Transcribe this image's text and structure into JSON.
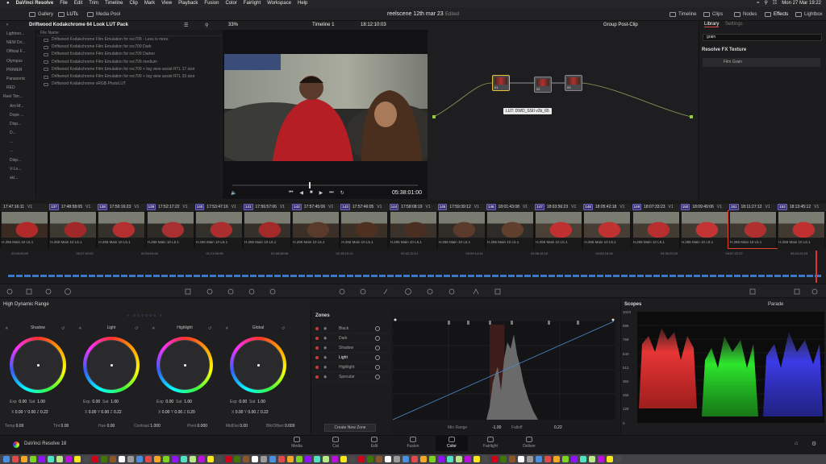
{
  "menubar": {
    "app": "DaVinci Resolve",
    "items": [
      "File",
      "Edit",
      "Trim",
      "Timeline",
      "Clip",
      "Mark",
      "View",
      "Playback",
      "Fusion",
      "Color",
      "Fairlight",
      "Workspace",
      "Help"
    ],
    "datetime": "Mon 27 Mar 19:22"
  },
  "pagebar": {
    "gallery": "Gallery",
    "luts": "LUTs",
    "media_pool": "Media Pool",
    "project_title": "reelscene 12th mar 23",
    "edited": "Edited",
    "timeline": "Timeline",
    "clips": "Clips",
    "nodes": "Nodes",
    "effects": "Effects",
    "lightbox": "Lightbox"
  },
  "toolbar": {
    "lut_pack": "Driftwood Kodakchrome 64 Look LUT Pack",
    "zoom": "33%",
    "timeline_name": "Timeline 1",
    "timecode": "18:12:10:03",
    "node_mode": "Group Post-Clip",
    "library_tab": "Library",
    "settings_tab": "Settings"
  },
  "sidebar": {
    "items": [
      "Lightroo...",
      "NEW Dri...",
      "Official F...",
      "Olympus",
      "PRIMER",
      "Panasonic",
      "RED",
      "Reel Tim...",
      "Arri M...",
      "Dope ...",
      "Disp...",
      "D...",
      "...",
      "...",
      "Disp...",
      "V-Lo...",
      "ski..."
    ]
  },
  "lut_list": {
    "header": "File Name",
    "items": [
      "Driftwood Kodakchrome Film Emulation for rec709 - Less is more",
      "Driftwood Kodakchrome Film Emulation for rec709 Dark",
      "Driftwood Kodakchrome Film Emulation for rec709 Darker",
      "Driftwood Kodakchrome Film Emulation for rec709 medium",
      "Driftwood Kodakchrome Film Emulation for rec709 + log view assist RTL 17 size",
      "Driftwood Kodakchrome Film Emulation for rec709 + log view assist RTL 33 size",
      "Driftwood Kodakchrome sRGB PhotoLUT"
    ]
  },
  "viewer": {
    "timecode": "05:38:01:00"
  },
  "nodes": {
    "labels": [
      "01",
      "02",
      "03"
    ],
    "tooltip": "LUT: DWD_SSII v2b_65"
  },
  "library": {
    "search_value": "grain",
    "section_title": "Resolve FX Texture",
    "effect_item": "Film Grain"
  },
  "clips": [
    {
      "num": "",
      "tc": "17:47:16:11",
      "track": "V1"
    },
    {
      "num": "137",
      "tc": "17:48:58:05",
      "track": "V1"
    },
    {
      "num": "138",
      "tc": "17:50:16:23",
      "track": "V1"
    },
    {
      "num": "139",
      "tc": "17:52:17:22",
      "track": "V1"
    },
    {
      "num": "140",
      "tc": "17:53:47:16",
      "track": "V1"
    },
    {
      "num": "141",
      "tc": "17:56:57:06",
      "track": "V1"
    },
    {
      "num": "142",
      "tc": "17:57:45:06",
      "track": "V1"
    },
    {
      "num": "143",
      "tc": "17:57:46:05",
      "track": "V1"
    },
    {
      "num": "144",
      "tc": "17:58:08:19",
      "track": "V1"
    },
    {
      "num": "145",
      "tc": "17:59:39:12",
      "track": "V1"
    },
    {
      "num": "146",
      "tc": "18:01:43:08",
      "track": "V1"
    },
    {
      "num": "147",
      "tc": "18:03:56:23",
      "track": "V1"
    },
    {
      "num": "148",
      "tc": "18:05:42:18",
      "track": "V1"
    },
    {
      "num": "149",
      "tc": "18:07:33:23",
      "track": "V1"
    },
    {
      "num": "150",
      "tc": "18:09:49:06",
      "track": "V1"
    },
    {
      "num": "151",
      "tc": "18:11:27:12",
      "track": "V1"
    },
    {
      "num": "152",
      "tc": "18:13:45:12",
      "track": "V1"
    }
  ],
  "clip_caption": "H.265 Main 10 L5.1",
  "ruler_ticks": [
    "00:00:00:00",
    "00:27:02:02",
    "00:54:04:04",
    "01:21:06:06",
    "01:48:08:08",
    "02:15:10:10",
    "02:42:12:12",
    "03:09:14:14",
    "03:36:16:16",
    "04:03:18:18",
    "04:30:20:20",
    "04:57:22:22",
    "05:24:24:24"
  ],
  "color_panel": {
    "title": "High Dynamic Range",
    "wheels": [
      {
        "name": "Shadow",
        "exp": "0.00",
        "sat": "1.00",
        "x": "0.00",
        "y": "0.00",
        "z": "0.22"
      },
      {
        "name": "Light",
        "exp": "0.00",
        "sat": "1.00",
        "x": "0.00",
        "y": "0.00",
        "z": "0.22"
      },
      {
        "name": "Highlight",
        "exp": "0.00",
        "sat": "1.00",
        "x": "0.00",
        "y": "0.00",
        "z": "0.20"
      },
      {
        "name": "Global",
        "exp": "0.00",
        "sat": "1.00",
        "x": "0.00",
        "y": "0.00",
        "z": "0.22"
      }
    ],
    "bottom": {
      "temp_label": "Temp",
      "temp": "0.00",
      "tint_label": "Tint",
      "tint": "0.00",
      "hue_label": "Hue",
      "hue": "0.00",
      "contrast_label": "Contrast",
      "contrast": "1.000",
      "pivot_label": "Pivot",
      "pivot": "0.000",
      "middetail_label": "MidDet",
      "middetail": "0.00",
      "blkoffset_label": "Blk/Offset",
      "blkoffset": "0.000"
    }
  },
  "zones": {
    "title": "Zones",
    "items": [
      "Black",
      "Dark",
      "Shadow",
      "Light",
      "Highlight",
      "Specular"
    ],
    "create_button": "Create New Zone"
  },
  "zone_graph": {
    "min_range_label": "Min Range",
    "min_range": "-1.00",
    "falloff_label": "Falloff",
    "falloff": "0.22"
  },
  "scopes": {
    "title": "Scopes",
    "mode": "Parade",
    "ticks": [
      "1023",
      "896",
      "768",
      "640",
      "512",
      "384",
      "256",
      "128",
      "0"
    ]
  },
  "pages": [
    "Media",
    "Cut",
    "Edit",
    "Fusion",
    "Color",
    "Fairlight",
    "Deliver"
  ],
  "active_page": "Color",
  "brand": "DaVinci Resolve 18"
}
